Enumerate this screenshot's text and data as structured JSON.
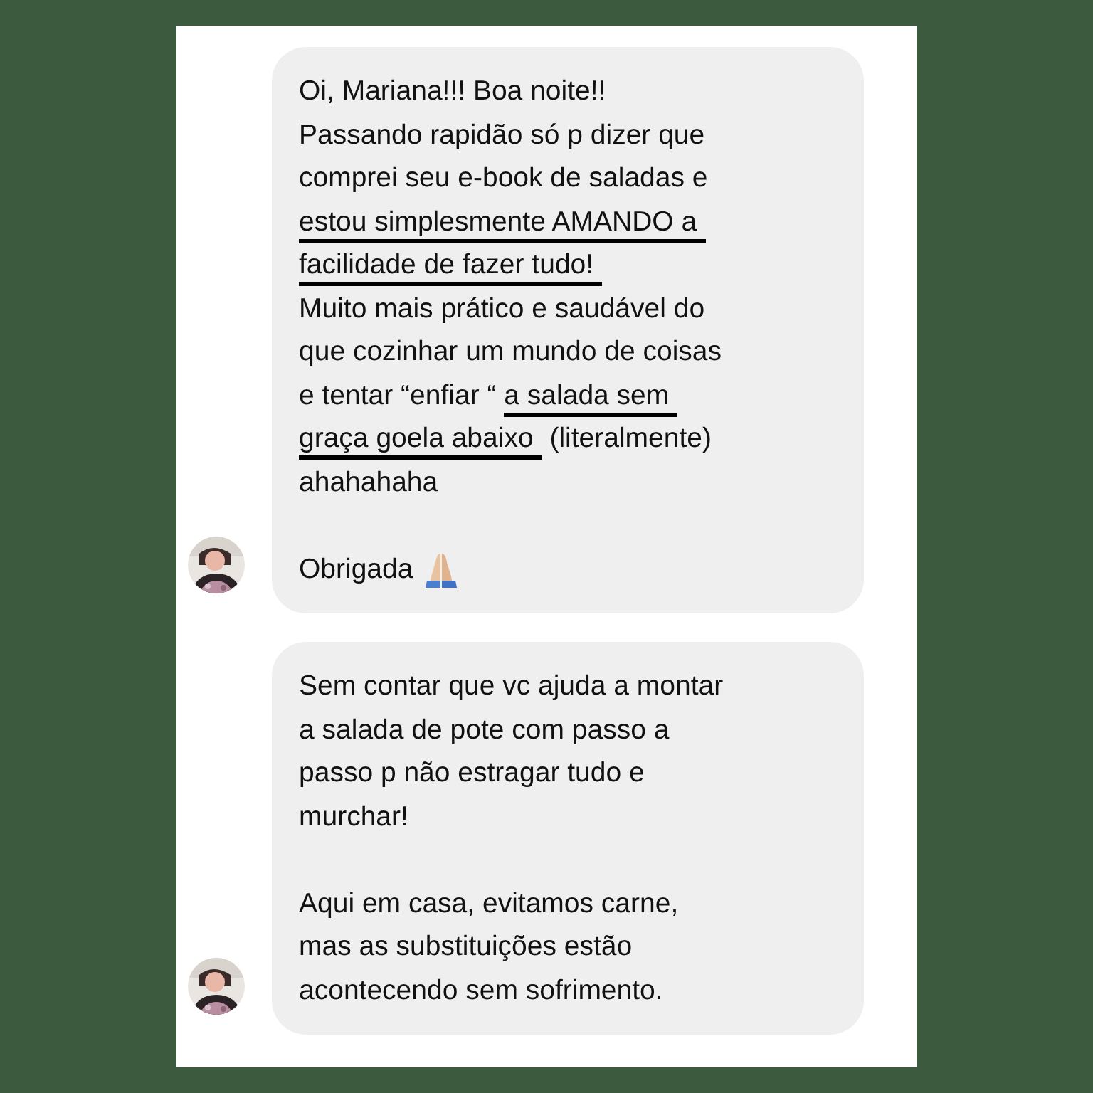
{
  "messages": [
    {
      "paragraphs": [
        [
          {
            "kind": "text",
            "segments": [
              {
                "text": "Oi, Mariana!!! Boa noite!!",
                "underlined": false
              }
            ]
          },
          {
            "kind": "text",
            "segments": [
              {
                "text": "Passando rapidão só p dizer que",
                "underlined": false
              }
            ]
          },
          {
            "kind": "text",
            "segments": [
              {
                "text": "comprei seu e-book de saladas e",
                "underlined": false
              }
            ]
          },
          {
            "kind": "text",
            "segments": [
              {
                "text": "estou simplesmente AMANDO a",
                "underlined": true
              }
            ]
          },
          {
            "kind": "text",
            "segments": [
              {
                "text": "facilidade de fazer tudo!",
                "underlined": true
              }
            ]
          },
          {
            "kind": "text",
            "segments": [
              {
                "text": "Muito mais prático e saudável do",
                "underlined": false
              }
            ]
          },
          {
            "kind": "text",
            "segments": [
              {
                "text": "que cozinhar um mundo de coisas",
                "underlined": false
              }
            ]
          },
          {
            "kind": "text",
            "segments": [
              {
                "text": "e tentar “enfiar “ ",
                "underlined": false
              },
              {
                "text": "a salada sem",
                "underlined": true
              }
            ]
          },
          {
            "kind": "text",
            "segments": [
              {
                "text": "graça goela abaixo",
                "underlined": true
              },
              {
                "text": " (literalmente)",
                "underlined": false
              }
            ]
          },
          {
            "kind": "text",
            "segments": [
              {
                "text": "ahahahaha",
                "underlined": false
              }
            ]
          }
        ],
        [
          {
            "kind": "text-with-hands-icon",
            "segments": [
              {
                "text": "Obrigada",
                "underlined": false
              }
            ]
          }
        ]
      ]
    },
    {
      "paragraphs": [
        [
          {
            "kind": "text",
            "segments": [
              {
                "text": "Sem contar que vc ajuda a montar",
                "underlined": false
              }
            ]
          },
          {
            "kind": "text",
            "segments": [
              {
                "text": "a salada de pote com passo a",
                "underlined": false
              }
            ]
          },
          {
            "kind": "text",
            "segments": [
              {
                "text": "passo p não estragar tudo e",
                "underlined": false
              }
            ]
          },
          {
            "kind": "text",
            "segments": [
              {
                "text": "murchar!",
                "underlined": false
              }
            ]
          }
        ],
        [
          {
            "kind": "text",
            "segments": [
              {
                "text": "Aqui em casa, evitamos carne,",
                "underlined": false
              }
            ]
          },
          {
            "kind": "text",
            "segments": [
              {
                "text": "mas as substituições estão",
                "underlined": false
              }
            ]
          },
          {
            "kind": "text",
            "segments": [
              {
                "text": "acontecendo sem sofrimento.",
                "underlined": false
              }
            ]
          }
        ]
      ]
    }
  ]
}
